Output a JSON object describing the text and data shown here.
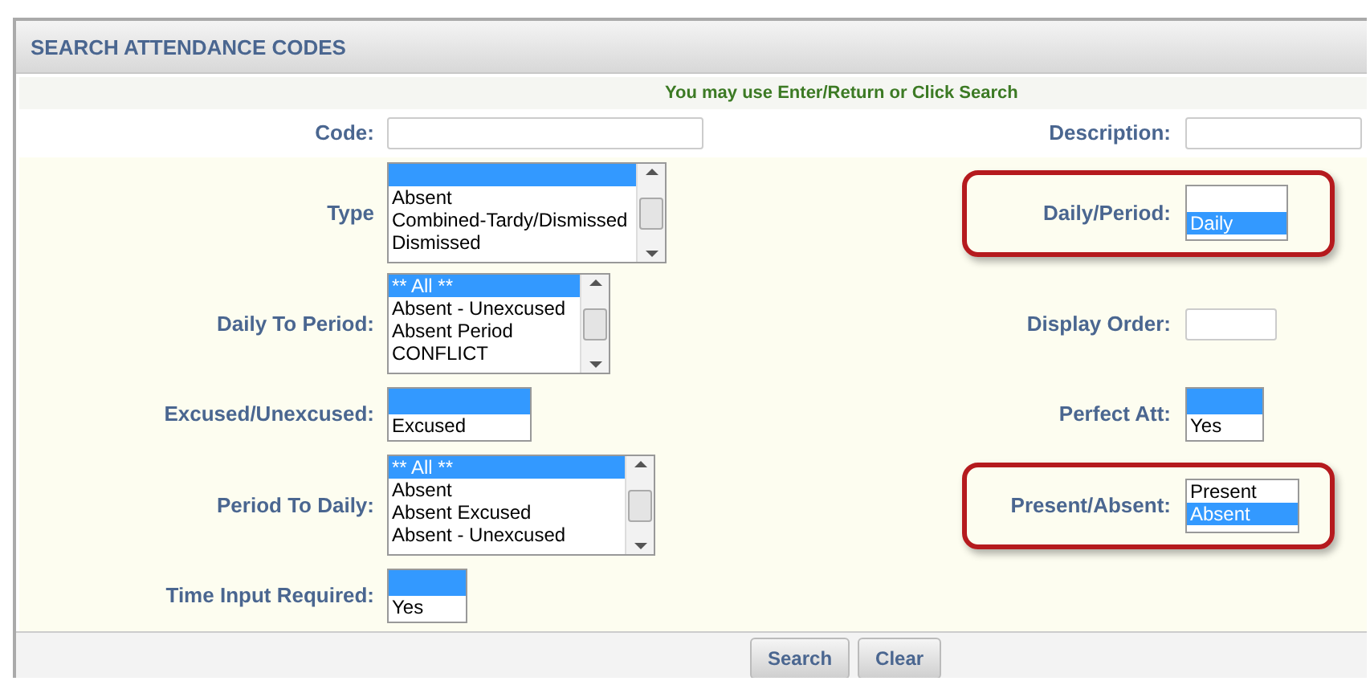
{
  "panel": {
    "title": "SEARCH ATTENDANCE CODES",
    "hint": "You may use Enter/Return or Click Search"
  },
  "rows": [
    {
      "cells": [
        {
          "label": "Code:",
          "kind": "text",
          "highlighted": false
        },
        {
          "label": "Description:",
          "kind": "text",
          "highlighted": false
        }
      ]
    },
    {
      "cells": [
        {
          "label": "Type",
          "kind": "listbox",
          "scroll": true,
          "highlighted": false,
          "options": [
            {
              "selected": true
            },
            {
              "label": "Absent",
              "selected": false
            },
            {
              "label": "Combined-Tardy/Dismissed",
              "selected": false
            },
            {
              "label": "Dismissed",
              "selected": false
            }
          ]
        },
        {
          "label": "Daily/Period:",
          "kind": "listbox",
          "scroll": false,
          "highlighted": true,
          "options": [
            {
              "label": "Daily",
              "selected": true
            }
          ]
        }
      ]
    },
    {
      "cells": [
        {
          "label": "Daily To Period:",
          "kind": "listbox",
          "scroll": true,
          "highlighted": false,
          "options": [
            {
              "label": "** All **",
              "selected": true
            },
            {
              "label": "Absent - Unexcused",
              "selected": false
            },
            {
              "label": "Absent Period",
              "selected": false
            },
            {
              "label": "CONFLICT",
              "selected": false
            }
          ]
        },
        {
          "label": "Display Order:",
          "kind": "text",
          "highlighted": false
        }
      ]
    },
    {
      "cells": [
        {
          "label": "Excused/Unexcused:",
          "kind": "listbox",
          "scroll": false,
          "highlighted": false,
          "options": [
            {
              "selected": true
            },
            {
              "label": "Excused",
              "selected": false
            }
          ]
        },
        {
          "label": "Perfect Att:",
          "kind": "listbox",
          "scroll": false,
          "highlighted": false,
          "options": [
            {
              "selected": true
            },
            {
              "label": "Yes",
              "selected": false
            }
          ]
        }
      ]
    },
    {
      "cells": [
        {
          "label": "Period To Daily:",
          "kind": "listbox",
          "scroll": true,
          "highlighted": false,
          "options": [
            {
              "label": "** All **",
              "selected": true
            },
            {
              "label": "Absent",
              "selected": false
            },
            {
              "label": "Absent Excused",
              "selected": false
            },
            {
              "label": "Absent - Unexcused",
              "selected": false
            }
          ]
        },
        {
          "label": "Present/Absent:",
          "kind": "listbox",
          "scroll": false,
          "highlighted": true,
          "options": [
            {
              "label": "Present",
              "selected": false
            },
            {
              "label": "Absent",
              "selected": true
            }
          ]
        }
      ]
    },
    {
      "cells": [
        {
          "label": "Time Input Required:",
          "kind": "listbox",
          "scroll": false,
          "highlighted": false,
          "options": [
            {
              "selected": true
            },
            {
              "label": "Yes",
              "selected": false
            }
          ]
        }
      ]
    }
  ],
  "buttons": [
    "Search",
    "Clear"
  ]
}
